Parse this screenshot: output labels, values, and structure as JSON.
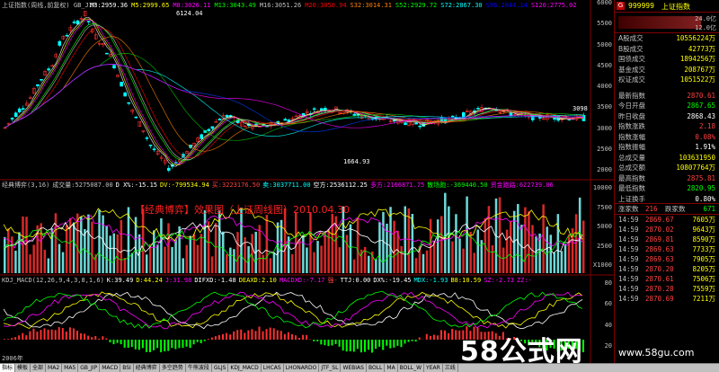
{
  "header": {
    "title": "上证指数(周线,前复权) GB_JIP",
    "ma": [
      {
        "label": "M3:2959.36",
        "color": "#ffffff"
      },
      {
        "label": "M5:2999.65",
        "color": "#ffff00"
      },
      {
        "label": "M8:3026.11",
        "color": "#ff00ff"
      },
      {
        "label": "M13:3043.49",
        "color": "#00ff00"
      },
      {
        "label": "M16:3051.26",
        "color": "#c0c0c0"
      },
      {
        "label": "M20:3050.94",
        "color": "#ff0000"
      },
      {
        "label": "S32:3014.31",
        "color": "#ff8000"
      },
      {
        "label": "S52:2929.72",
        "color": "#00ff00"
      },
      {
        "label": "S72:2867.30",
        "color": "#00ffff"
      },
      {
        "label": "S96:2844.14",
        "color": "#0000ff"
      },
      {
        "label": "S120:2775.02",
        "color": "#ff00ff"
      }
    ]
  },
  "price_axis": [
    "6000",
    "5500",
    "5000",
    "4500",
    "4000",
    "3500",
    "3000",
    "2500",
    "2000"
  ],
  "annotations": {
    "high": "6124.04",
    "low": "1664.93",
    "last": "3098"
  },
  "volume_header": {
    "items": [
      {
        "label": "经典博弈(3,16)",
        "color": "#c0c0c0"
      },
      {
        "label": "成交量:5275087.00",
        "color": "#c0c0c0"
      },
      {
        "label": "D X%:-15.15",
        "color": "#ffffff"
      },
      {
        "label": "DV:-799534.94",
        "color": "#ffff00"
      },
      {
        "label": "买:3223176.50",
        "color": "#ff4040"
      },
      {
        "label": "卖:3037711.00",
        "color": "#00ffff"
      },
      {
        "label": "空方:2536112.25",
        "color": "#ffffff"
      },
      {
        "label": "多方:2166871.75",
        "color": "#ff00ff"
      },
      {
        "label": "散场跑:-369440.50",
        "color": "#00ff00"
      },
      {
        "label": "资金跑路:622739.06",
        "color": "#ff00ff"
      }
    ]
  },
  "volume_title": "【经典博弈】效果图（上证周线图）2010.04.30",
  "volume_axis": [
    "10000",
    "7500",
    "5000",
    "2500",
    "X1000"
  ],
  "macd_header": {
    "items": [
      {
        "label": "KDJ_MACD(12,26,9,4,3,8,1,6)",
        "color": "#c0c0c0"
      },
      {
        "label": "K:39.49",
        "color": "#ffffff"
      },
      {
        "label": "D:44.24",
        "color": "#ffff00"
      },
      {
        "label": "J:31.98",
        "color": "#ff00ff"
      },
      {
        "label": "DIFXD:-1.48",
        "color": "#ffffff"
      },
      {
        "label": "DEAXD:2.10",
        "color": "#ffff00"
      },
      {
        "label": "MACDXD:-7.17",
        "color": "#ff00ff"
      },
      {
        "label": "强-",
        "color": "#ff4040"
      },
      {
        "label": "TTJ:0.00",
        "color": "#ffffff"
      },
      {
        "label": "DX%:-19.45",
        "color": "#ffffff"
      },
      {
        "label": "MDX:-1.93",
        "color": "#00ffff"
      },
      {
        "label": "B8:10.59",
        "color": "#ffff00"
      },
      {
        "label": "SZ:-2.73",
        "color": "#ff00ff"
      },
      {
        "label": "ZZ:-",
        "color": "#ff00ff"
      }
    ]
  },
  "macd_axis": [
    "80",
    "60",
    "40",
    "20"
  ],
  "date_label": "2006年",
  "watermark": {
    "text": "58公式网",
    "url": "www.58gu.com"
  },
  "quote": {
    "code": "999999",
    "name": "上证指数",
    "change_top": "24.0亿",
    "change_bottom": "12.0亿",
    "rows": [
      {
        "k": "A股成交",
        "v": "10556224万",
        "c": "#ffff00"
      },
      {
        "k": "B股成交",
        "v": "42773万",
        "c": "#ffff00"
      },
      {
        "k": "国债成交",
        "v": "1894256万",
        "c": "#ffff00"
      },
      {
        "k": "基金成交",
        "v": "208767万",
        "c": "#ffff00"
      },
      {
        "k": "权证成交",
        "v": "1051522万",
        "c": "#ffff00"
      },
      {
        "k": "最新指数",
        "v": "2870.61",
        "c": "#ff4040"
      },
      {
        "k": "今日开盘",
        "v": "2867.65",
        "c": "#00ff00"
      },
      {
        "k": "昨日收盘",
        "v": "2868.43",
        "c": "#ffffff"
      },
      {
        "k": "指数涨跌",
        "v": "2.18",
        "c": "#ff4040"
      },
      {
        "k": "指数涨幅",
        "v": "0.08%",
        "c": "#ff4040"
      },
      {
        "k": "指数振幅",
        "v": "1.91%",
        "c": "#ffffff"
      },
      {
        "k": "总成交量",
        "v": "103631950",
        "c": "#ffff00"
      },
      {
        "k": "总成交额",
        "v": "10807764万",
        "c": "#ffff00"
      },
      {
        "k": "最高指数",
        "v": "2875.81",
        "c": "#ff4040"
      },
      {
        "k": "最低指数",
        "v": "2820.95",
        "c": "#00ff00"
      },
      {
        "k": "上证换手",
        "v": "0.80%",
        "c": "#ffffff"
      }
    ],
    "updown": {
      "up_label": "涨家数",
      "up": "216",
      "down_label": "跌家数",
      "down": "671"
    },
    "trades": [
      {
        "t": "14:59",
        "p": "2869.67",
        "q": "7605万"
      },
      {
        "t": "14:59",
        "p": "2870.02",
        "q": "9643万"
      },
      {
        "t": "14:59",
        "p": "2869.81",
        "q": "8590万"
      },
      {
        "t": "14:59",
        "p": "2869.63",
        "q": "7733万"
      },
      {
        "t": "14:59",
        "p": "2869.63",
        "q": "7905万"
      },
      {
        "t": "14:59",
        "p": "2870.20",
        "q": "8205万"
      },
      {
        "t": "14:59",
        "p": "2870.61",
        "q": "7506万"
      },
      {
        "t": "14:59",
        "p": "2870.28",
        "q": "7559万"
      },
      {
        "t": "14:59",
        "p": "2870.69",
        "q": "7211万"
      }
    ]
  },
  "tabs": [
    "指标",
    "模板",
    "全部",
    "MA2",
    "MA5",
    "GB_JIP",
    "MACD",
    "BSI",
    "经典博弈",
    "多空趋势",
    "牛熊波段",
    "GLJS",
    "KDJ_MACD",
    "LHCAS",
    "LHONARDO",
    "JTF_SL",
    "WEBIAS",
    "BOLL",
    "MA",
    "BOLL_W",
    "YEAR",
    "三线"
  ]
}
